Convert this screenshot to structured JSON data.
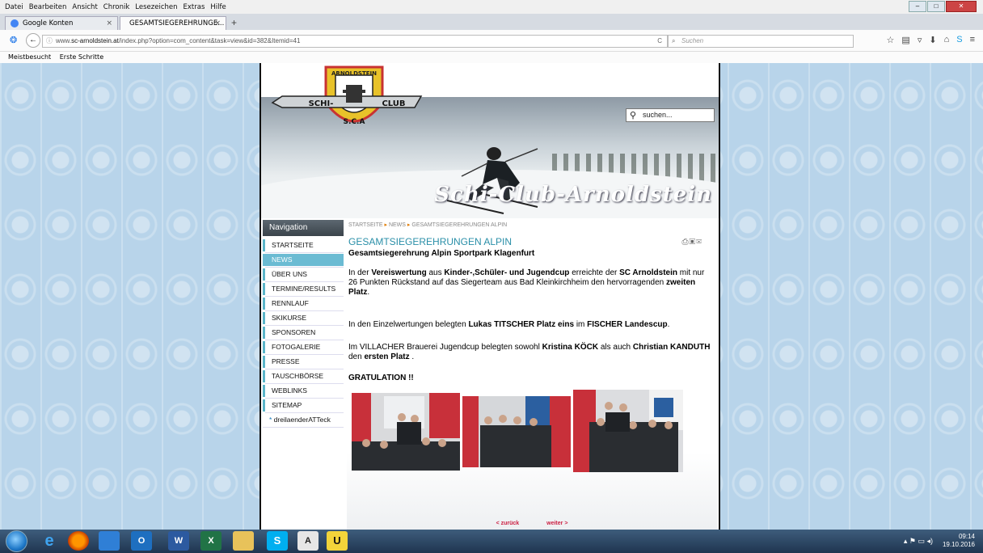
{
  "browser": {
    "menu": [
      "Datei",
      "Bearbeiten",
      "Ansicht",
      "Chronik",
      "Lesezeichen",
      "Extras",
      "Hilfe"
    ],
    "tabs": [
      {
        "label": "Google Konten"
      },
      {
        "label": "GESAMTSIEGEREHRUNGE..."
      }
    ],
    "url_domain": "www.sc-arnoldstein.at",
    "url_path": "/index.php?option=com_content&task=view&id=382&Itemid=41",
    "url_prefix": "www.",
    "search_placeholder": "Suchen",
    "bookmarks": [
      "Meistbesucht",
      "Erste Schritte"
    ]
  },
  "site": {
    "logo_top": "ARNOLDSTEIN",
    "logo_left": "SCHI-",
    "logo_right": "CLUB",
    "logo_bottom": "S.C.A",
    "brand": "Schi-Club-Arnoldstein",
    "search_value": "suchen..."
  },
  "nav": {
    "heading": "Navigation",
    "items": [
      {
        "label": "STARTSEITE"
      },
      {
        "label": "NEWS"
      },
      {
        "label": "ÜBER UNS"
      },
      {
        "label": "TERMINE/RESULTS"
      },
      {
        "label": "RENNLAUF"
      },
      {
        "label": "SKIKURSE"
      },
      {
        "label": "SPONSOREN"
      },
      {
        "label": "FOTOGALERIE"
      },
      {
        "label": "PRESSE"
      },
      {
        "label": "TAUSCHBÖRSE"
      },
      {
        "label": "WEBLINKS"
      },
      {
        "label": "SITEMAP"
      },
      {
        "label": "dreilaenderATTeck"
      }
    ]
  },
  "article": {
    "breadcrumb": [
      "STARTSEITE",
      "NEWS",
      "GESAMTSIEGEREHRUNGEN ALPIN"
    ],
    "title": "GESAMTSIEGEREHRUNGEN ALPIN",
    "subtitle": "Gesamtsiegerehrung Alpin Sportpark Klagenfurt",
    "p1": {
      "a": "In der ",
      "b": "Vereiswertung",
      "c": " aus ",
      "d": "Kinder-,Schüler- und Jugendcup",
      "e": " erreichte der ",
      "f": "SC Arnoldstein",
      "g": " mit nur 26 Punkten Rückstand auf das Siegerteam aus Bad Kleinkirchheim den hervorragenden ",
      "h": "zweiten Platz",
      "i": "."
    },
    "p2": {
      "a": "In den Einzelwertungen belegten ",
      "b": "Lukas TITSCHER  Platz eins",
      "c": " im ",
      "d": "FISCHER Landescup",
      "e": "."
    },
    "p3": {
      "a": "Im VILLACHER Brauerei Jugendcup belegten sowohl ",
      "b": "Kristina KÖCK",
      "c": " als auch ",
      "d": "Christian KANDUTH",
      "e": " den ",
      "f": "ersten Platz",
      "g": " ."
    },
    "gratulation": "GRATULATION !!",
    "prev": "< zurück",
    "next": "weiter >"
  },
  "taskbar": {
    "time": "09:14",
    "date": "19.10.2016"
  }
}
